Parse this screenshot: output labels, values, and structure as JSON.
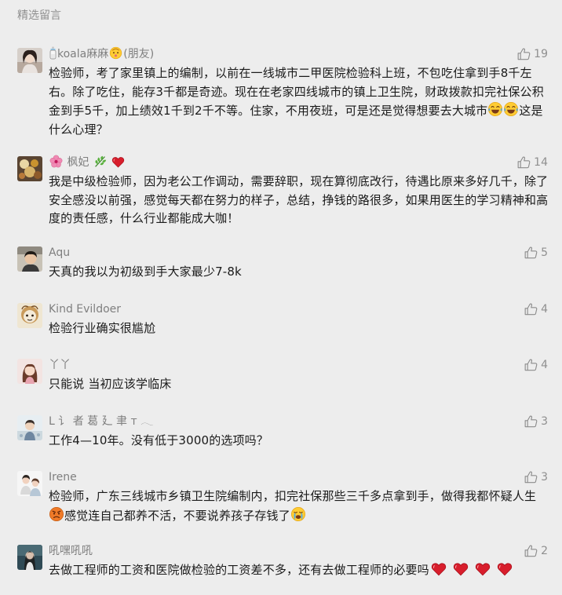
{
  "section_title": "精选留言",
  "comments": [
    {
      "name_parts": [
        "koala麻麻",
        "(朋友)"
      ],
      "likes": "19",
      "text_parts": [
        "检验师，考了家里镇上的编制，以前在一线城市二甲医院检验科上班，不包吃住拿到手8千左右。除了吃住，能存3千都是奇迹。现在在老家四线城市的镇上卫生院，财政拨款扣完社保公积金到手5千，加上绩效1千到2千不等。住家，不用夜班，可是还是觉得想要去大城市",
        "这是什么心理？"
      ],
      "icons": [
        "baby-bottle-icon",
        "baby-face-icon",
        "tears-of-joy-emoji",
        "tears-of-joy-emoji"
      ]
    },
    {
      "name_parts": [
        "枫妃"
      ],
      "likes": "14",
      "text_parts": [
        "我是中级检验师，因为老公工作调动，需要辞职，现在算彻底改行，待遇比原来多好几千，除了安全感没以前强，感觉每天都在努力的样子，总结，挣钱的路很多，如果用医生的学习精神和高度的责任感，什么行业都能成大咖！"
      ],
      "icons": [
        "hibiscus-icon",
        "herb-icon",
        "heart-icon"
      ]
    },
    {
      "name_parts": [
        "Aqu"
      ],
      "likes": "5",
      "text_parts": [
        "天真的我以为初级到手大家最少7-8k"
      ]
    },
    {
      "name_parts": [
        "Kind Evildoer"
      ],
      "likes": "4",
      "text_parts": [
        "检验行业确实很尴尬"
      ]
    },
    {
      "name_parts": [
        "丫丫"
      ],
      "likes": "4",
      "text_parts": [
        "只能说 当初应该学临床"
      ]
    },
    {
      "name_parts": [
        "ᒪ 讠 者 葛 廴 聿 ᴛ 𓂃"
      ],
      "likes": "3",
      "text_parts": [
        "工作4—10年。没有低于3000的选项吗？"
      ]
    },
    {
      "name_parts": [
        "Irene"
      ],
      "likes": "3",
      "text_parts": [
        "检验师，广东三线城市乡镇卫生院编制内，扣完社保那些三千多点拿到手，做得我都怀疑人生",
        "感觉连自己都养不活，不要说养孩子存钱了"
      ],
      "icons": [
        "angry-face-emoji",
        "loudly-crying-emoji"
      ]
    },
    {
      "name_parts": [
        "吼嘿吼吼"
      ],
      "likes": "2",
      "text_parts": [
        "去做工程师的工资和医院做检验的工资差不多，还有去做工程师的必要吗"
      ],
      "icons": [
        "heart-icon",
        "heart-icon",
        "heart-icon",
        "heart-icon"
      ]
    }
  ],
  "colors": {
    "background": "#ededed",
    "body_text": "#1a1a1a",
    "meta_text": "#8f8f8f",
    "heart": "#d81e2c",
    "emoji_yellow": "#ffcc33"
  }
}
